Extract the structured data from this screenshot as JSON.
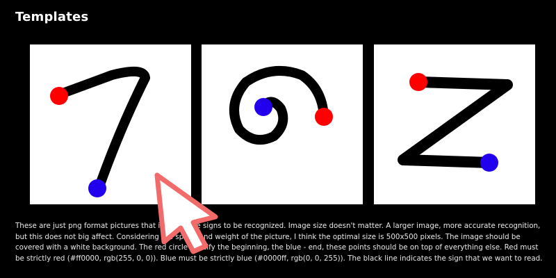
{
  "page": {
    "title": "Templates",
    "description": "These are just png format pictures that indicate the signs to be recognized. Image size doesn't matter. A larger image, more accurate recognition, but this does not big affect. Considering the speed and weight of the picture, I think the optimal size is 500x500 pixels. The image should be covered with a white background. The red circle specify the beginning, the blue - end, these points should be on top of everything else. Red must be strictly red (#ff0000, rgb(255, 0, 0)). Blue must be strictly blue (#0000ff, rgb(0, 0, 255)). The black line indicates the sign that we want to read."
  },
  "templates": [
    {
      "name": "seven",
      "start_color": "#ff0000",
      "end_color": "#2200ee"
    },
    {
      "name": "spiral",
      "start_color": "#ff0000",
      "end_color": "#2200ee"
    },
    {
      "name": "z",
      "start_color": "#ff0000",
      "end_color": "#2200ee"
    }
  ],
  "colors": {
    "background": "#000000",
    "tile": "#ffffff",
    "stroke": "#000000",
    "start_marker": "#ff0000",
    "end_marker": "#2200ee",
    "cursor_outline": "#f26b6b"
  },
  "icons": {
    "cursor": "mouse-pointer-arrow-icon"
  }
}
